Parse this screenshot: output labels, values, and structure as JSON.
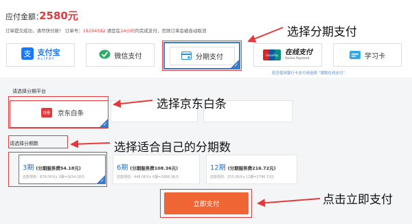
{
  "header": {
    "amount_label": "应付金额：",
    "amount_value": "2580元",
    "order_prefix": "订单提交成功，请尽快付款！  订单号：",
    "order_number": "18294592",
    "time_prefix": "   请您在",
    "time_limit": "24小时",
    "time_suffix": "内完成支付，否则订单会被自动取消"
  },
  "payment_methods": [
    {
      "name": "alipay",
      "label": "支付宝",
      "sub": "ALIPAY"
    },
    {
      "name": "wechat",
      "label": "微信支付"
    },
    {
      "name": "installment",
      "label": "分期支付"
    },
    {
      "name": "unionpay",
      "label": "在线支付",
      "sub": "Online Payment",
      "badge": "UnionPay"
    },
    {
      "name": "study-card",
      "label": "学习卡"
    }
  ],
  "hint": "若您使用银行卡支付请选择 “银联在线支付”",
  "platform": {
    "section_label": "请选择分期平台",
    "option_logo": "白条",
    "option_label": "京东白条"
  },
  "installment": {
    "section_label": "请选择分期数",
    "plans": [
      {
        "count": "3期",
        "fee": "(分期服务费54.18元)",
        "detail": "还款规则：878.06元x 3期=2634.18元"
      },
      {
        "count": "6期",
        "fee": "(分期服务费108.36元)",
        "detail": "还款规则：448.06元x 6期=2688.36元"
      },
      {
        "count": "12期",
        "fee": "(分期服务费216.72元)",
        "detail": "还款规则：233.06元x 12期=2796.72元"
      }
    ]
  },
  "submit_label": "立即支付",
  "annotations": {
    "choose_installment": "选择分期支付",
    "choose_baitiao": "选择京东白条",
    "choose_count": "选择适合自己的分期数",
    "click_pay": "点击立即支付"
  },
  "colors": {
    "accent_red": "#e4393c",
    "selected_blue": "#3b7ac7",
    "button_orange": "#f06534",
    "annotation_red": "#e23a3a"
  }
}
